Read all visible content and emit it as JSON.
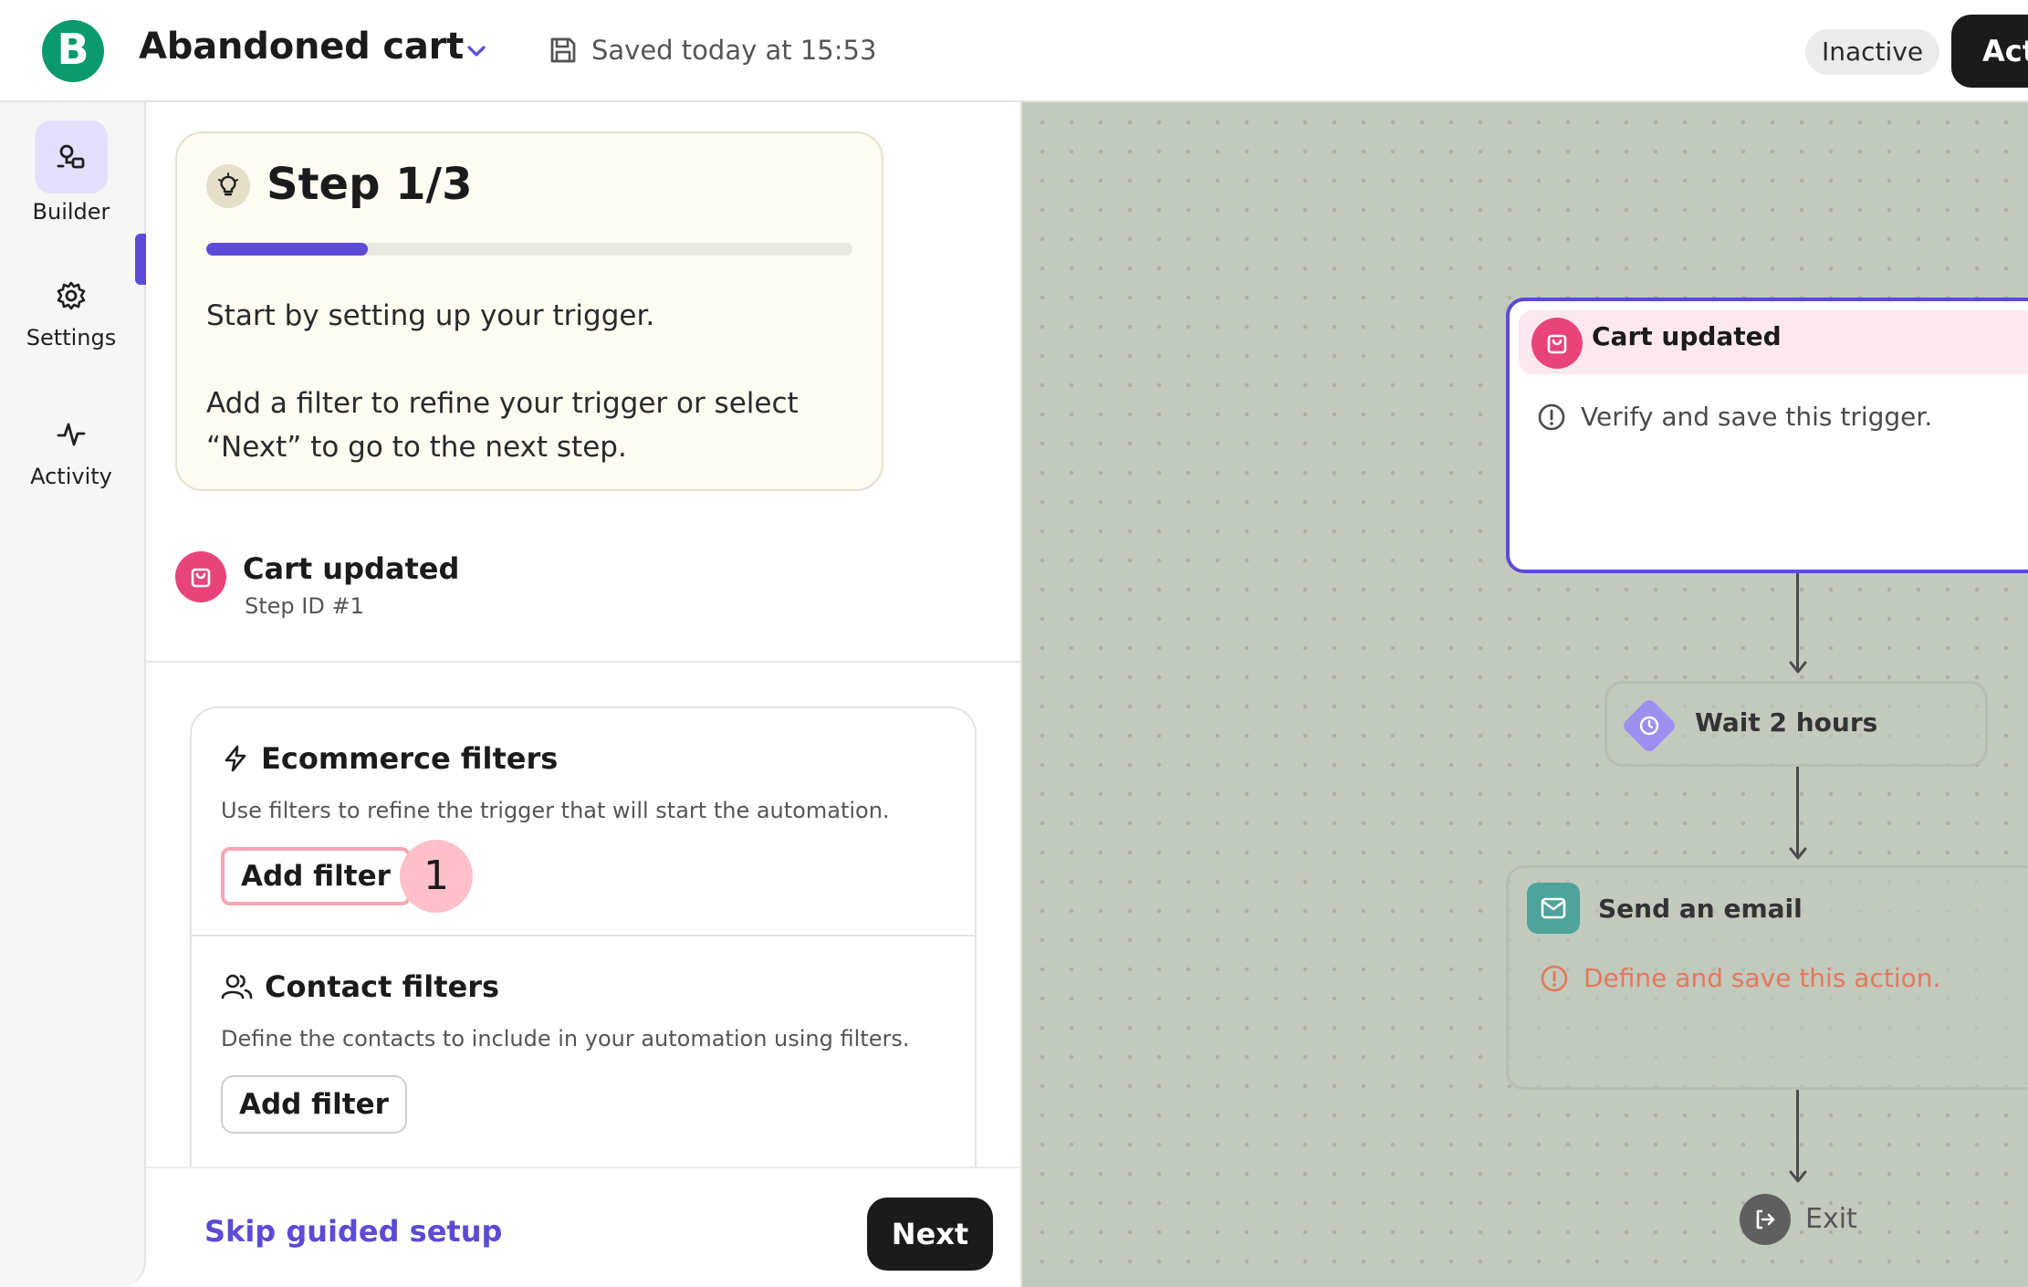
{
  "header": {
    "logo_letter": "B",
    "title": "Abandoned cart",
    "saved_status": "Saved today at 15:53",
    "status_badge": "Inactive",
    "activate_label": "Act"
  },
  "nav": {
    "items": [
      {
        "label": "Builder",
        "icon": "builder-icon",
        "active": true
      },
      {
        "label": "Settings",
        "icon": "gear-icon",
        "active": false
      },
      {
        "label": "Activity",
        "icon": "activity-icon",
        "active": false
      }
    ]
  },
  "guide": {
    "step_title": "Step 1/3",
    "progress": 0.25,
    "text1": "Start by setting up your trigger.",
    "text2": "Add a filter to refine your trigger or select “Next” to go to the next step."
  },
  "trigger": {
    "name": "Cart updated",
    "step_id": "Step ID #1"
  },
  "filters": {
    "ecommerce": {
      "title": "Ecommerce filters",
      "description": "Use filters to refine the trigger that will start the automation.",
      "button": "Add filter",
      "badge": "1"
    },
    "contact": {
      "title": "Contact filters",
      "description": "Define the contacts to include in your automation using filters.",
      "button": "Add filter"
    }
  },
  "footer": {
    "skip_label": "Skip guided setup",
    "next_label": "Next"
  },
  "canvas": {
    "trigger_node": {
      "title": "Cart updated",
      "message": "Verify and save this trigger."
    },
    "wait_node": {
      "label": "Wait 2 hours"
    },
    "email_node": {
      "title": "Send an email",
      "message": "Define and save this action."
    },
    "exit_label": "Exit"
  },
  "colors": {
    "accent": "#5b4bd6",
    "brand": "#0b996e",
    "trigger_pink": "#e8447a",
    "warning": "#e4795a",
    "canvas_bg": "#c2c9bd"
  }
}
